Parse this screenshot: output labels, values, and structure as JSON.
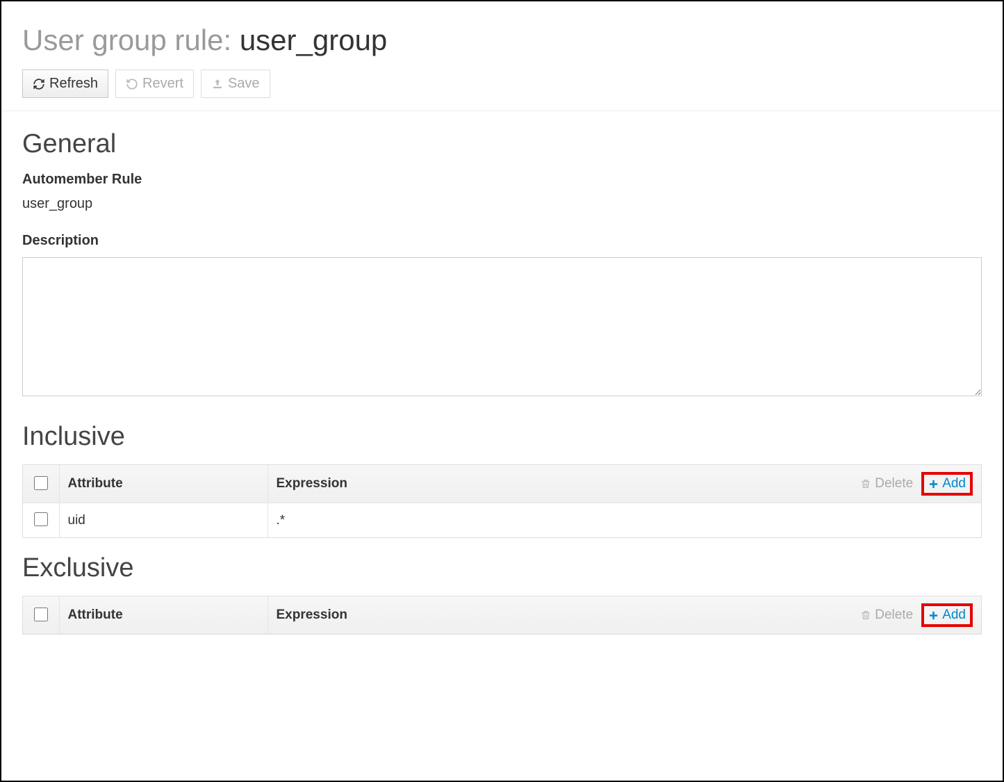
{
  "page": {
    "title_prefix": "User group rule: ",
    "rule_name": "user_group"
  },
  "toolbar": {
    "refresh": "Refresh",
    "revert": "Revert",
    "save": "Save"
  },
  "general": {
    "heading": "General",
    "automember_label": "Automember Rule",
    "automember_value": "user_group",
    "description_label": "Description",
    "description_value": ""
  },
  "inclusive": {
    "heading": "Inclusive",
    "col_attribute": "Attribute",
    "col_expression": "Expression",
    "delete_label": "Delete",
    "add_label": "Add",
    "rows": [
      {
        "attribute": "uid",
        "expression": ".*"
      }
    ]
  },
  "exclusive": {
    "heading": "Exclusive",
    "col_attribute": "Attribute",
    "col_expression": "Expression",
    "delete_label": "Delete",
    "add_label": "Add",
    "rows": []
  }
}
